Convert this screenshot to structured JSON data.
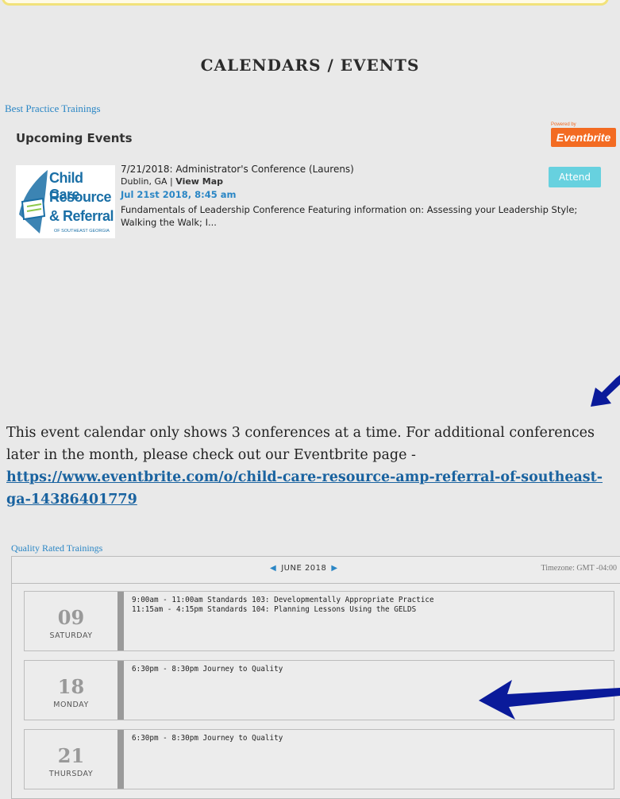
{
  "page_title": "CALENDARS / EVENTS",
  "eventbrite_section": {
    "link_label": "Best Practice Trainings",
    "heading": "Upcoming Events",
    "badge": {
      "powered_by": "Powered by",
      "brand": "Eventbrite",
      "brand_color": "#f36b22"
    },
    "org_logo": {
      "lines": [
        "Child Care",
        "Resource",
        "& Referral"
      ],
      "sub": "OF SOUTHEAST GEORGIA"
    },
    "event": {
      "title": "7/21/2018: Administrator's Conference (Laurens)",
      "location": "Dublin, GA | ",
      "map_link": "View Map",
      "datetime": "Jul 21st 2018, 8:45 am",
      "description": "Fundamentals of Leadership Conference Featuring information on: Assessing your Leadership Style; Walking the Walk; I...",
      "attend_label": "Attend"
    }
  },
  "note": {
    "text": "This event calendar only shows  3  conferences at a time. For additional conferences later in the month, please check out our Eventbrite page - ",
    "url": "https://www.eventbrite.com/o/child-care-resource-amp-referral-of-southeast-ga-14386401779"
  },
  "calendar": {
    "link_label": "Quality Rated Trainings",
    "month": "JUNE 2018",
    "timezone": "Timezone: GMT -04:00",
    "days": [
      {
        "num": "09",
        "name": "SATURDAY",
        "events": [
          "9:00am - 11:00am Standards 103: Developmentally Appropriate Practice",
          "11:15am - 4:15pm Standards 104: Planning Lessons Using the GELDS"
        ]
      },
      {
        "num": "18",
        "name": "MONDAY",
        "events": [
          "6:30pm - 8:30pm Journey to Quality"
        ]
      },
      {
        "num": "21",
        "name": "THURSDAY",
        "events": [
          "6:30pm - 8:30pm Journey to Quality"
        ]
      }
    ]
  },
  "colors": {
    "link": "#2a86c5",
    "attend_button": "#67d1df",
    "arrow": "#0a1a9a"
  }
}
